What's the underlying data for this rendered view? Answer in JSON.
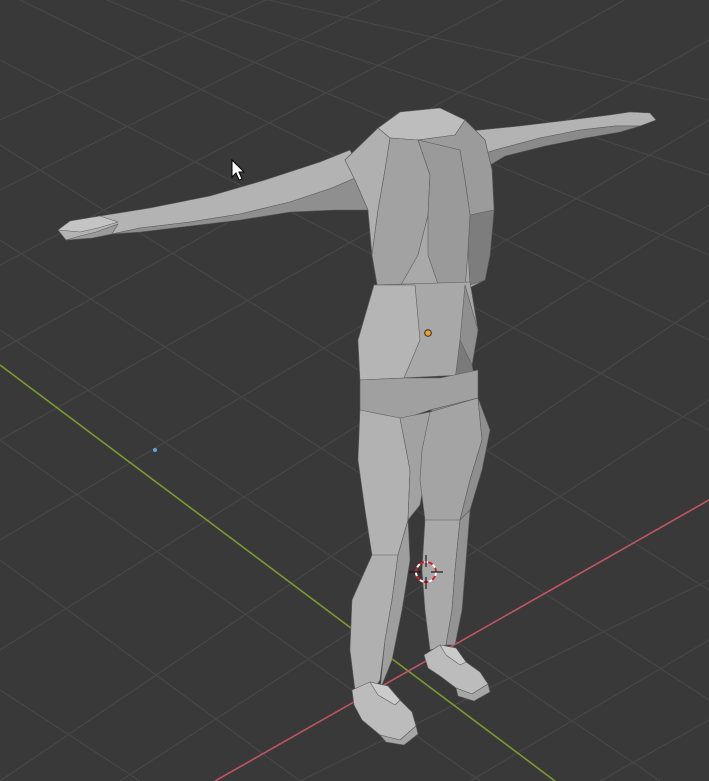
{
  "viewport": {
    "editor": "3D Viewport",
    "shading": "solid",
    "background_color": "#393939",
    "grid_line_color": "#474747",
    "x_axis_color": "#c05560",
    "y_axis_color": "#7c9a2c"
  },
  "scene": {
    "mesh_object": "humanoid-t-pose-low-poly",
    "mesh_color": "#a4a4a4",
    "object_origin_color": "#f0a030",
    "light_marker_color": "#5aa7e0",
    "cursor_3d": "3d-cursor-icon",
    "mouse_pointer": "mouse-pointer-icon"
  }
}
